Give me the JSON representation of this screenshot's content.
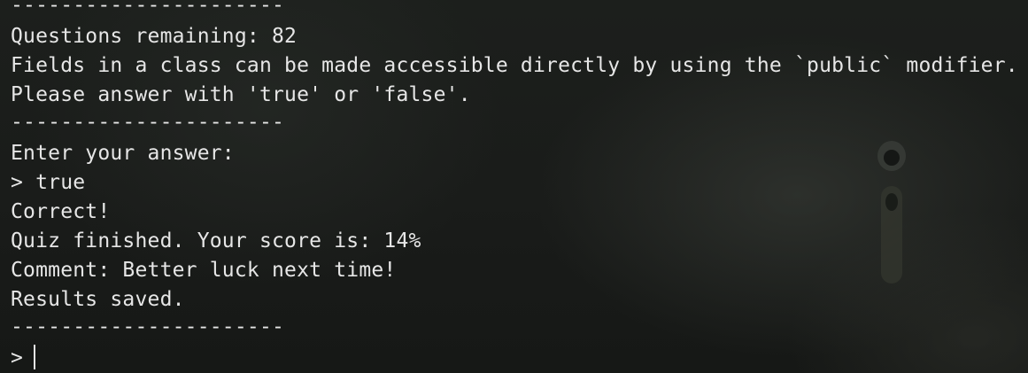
{
  "terminal": {
    "lines": [
      "----------------------",
      "Questions remaining: 82",
      "Fields in a class can be made accessible directly by using the `public` modifier.",
      "Please answer with 'true' or 'false'.",
      "----------------------",
      "Enter your answer:",
      "> true",
      "Correct!",
      "Quiz finished. Your score is: 14%",
      "Comment: Better luck next time!",
      "Results saved.",
      "----------------------"
    ],
    "prompt": ">"
  }
}
